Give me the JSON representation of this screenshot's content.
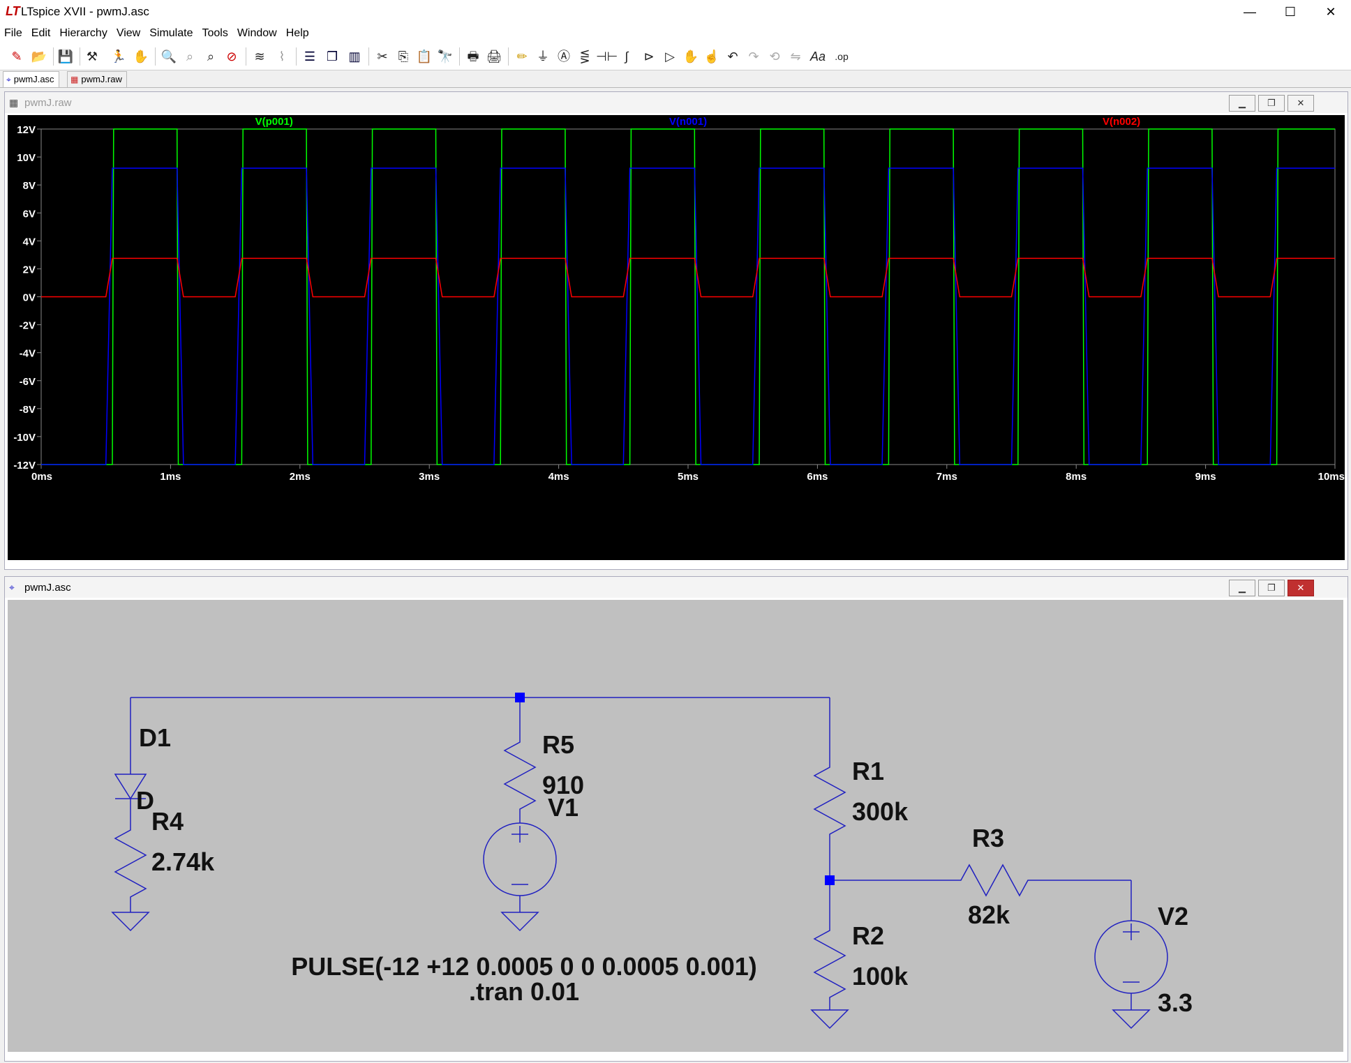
{
  "window": {
    "title": "LTspice XVII - pwmJ.asc"
  },
  "menu": [
    "File",
    "Edit",
    "Hierarchy",
    "View",
    "Simulate",
    "Tools",
    "Window",
    "Help"
  ],
  "toolbar_icons": [
    "new-schematic-icon",
    "open-icon",
    "save-icon",
    "control-panel-icon",
    "run-icon",
    "halt-icon",
    "zoom-in-icon",
    "zoom-fit-icon",
    "zoom-out-icon",
    "zoom-cancel-icon",
    "autorange-icon",
    "waveform-icon",
    "tile-horizontal-icon",
    "cascade-icon",
    "tile-vertical-icon",
    "cut-icon",
    "copy-icon",
    "paste-icon",
    "find-icon",
    "print-setup-icon",
    "print-icon",
    "draw-wire-icon",
    "ground-icon",
    "label-net-icon",
    "resistor-icon",
    "capacitor-icon",
    "inductor-icon",
    "diode-icon",
    "component-icon",
    "move-icon",
    "drag-icon",
    "undo-icon",
    "redo-icon",
    "rotate-icon",
    "mirror-icon",
    "text-icon",
    "spice-directive-icon"
  ],
  "tabs": [
    {
      "label": "pwmJ.asc",
      "icon": "schematic-icon"
    },
    {
      "label": "pwmJ.raw",
      "icon": "waveform-icon"
    }
  ],
  "plot_window": {
    "title": "pwmJ.raw"
  },
  "schematic_window": {
    "title": "pwmJ.asc"
  },
  "chart_data": {
    "type": "line",
    "x_unit": "ms",
    "xlim": [
      0,
      10
    ],
    "ylim": [
      -12,
      12
    ],
    "x_ticks": [
      "0ms",
      "1ms",
      "2ms",
      "3ms",
      "4ms",
      "5ms",
      "6ms",
      "7ms",
      "8ms",
      "9ms",
      "10ms"
    ],
    "y_ticks": [
      "12V",
      "10V",
      "8V",
      "6V",
      "4V",
      "2V",
      "0V",
      "-2V",
      "-4V",
      "-6V",
      "-8V",
      "-10V",
      "-12V"
    ],
    "series": [
      {
        "name": "V(p001)",
        "color": "#00ff00",
        "high": 12,
        "low": -12,
        "period": 1.0,
        "first_rise": 0.55,
        "high_duration": 0.5,
        "edge": 0.01
      },
      {
        "name": "V(n001)",
        "color": "#0000ff",
        "high": 9.2,
        "low": -12,
        "period": 1.0,
        "first_rise": 0.5,
        "high_duration": 0.55,
        "edge": 0.05
      },
      {
        "name": "V(n002)",
        "color": "#ff0000",
        "high": 2.75,
        "low": 0,
        "period": 1.0,
        "first_rise": 0.5,
        "high_duration": 0.55,
        "edge": 0.05
      }
    ]
  },
  "schematic": {
    "labels": {
      "d1_name": "D1",
      "d1_model": "D",
      "r4_name": "R4",
      "r4_value": "2.74k",
      "r5_name": "R5",
      "r5_value": "910",
      "v1_name": "V1",
      "r1_name": "R1",
      "r1_value": "300k",
      "r2_name": "R2",
      "r2_value": "100k",
      "r3_name": "R3",
      "r3_value": "82k",
      "v2_name": "V2",
      "v2_value": "3.3",
      "pulse": "PULSE(-12 +12 0.0005 0 0 0.0005 0.001)",
      "tran": ".tran 0.01"
    },
    "wire_color": "#2020c0",
    "node_color": "#0000ff"
  }
}
